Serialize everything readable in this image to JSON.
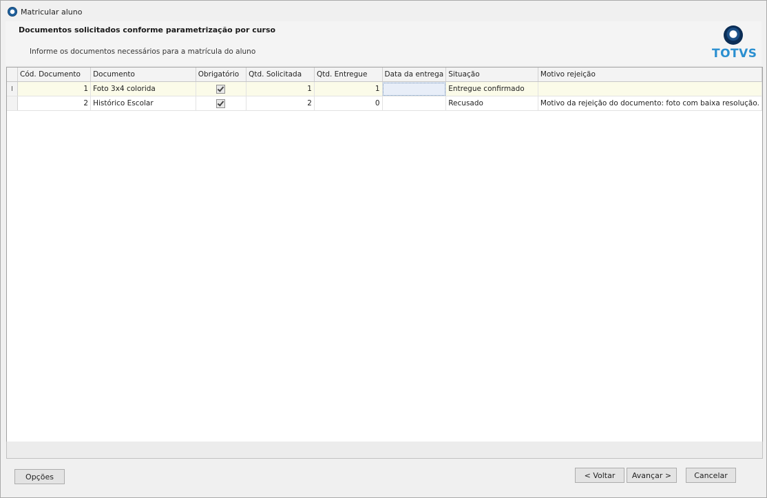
{
  "window": {
    "title": "Matricular aluno"
  },
  "header": {
    "title": "Documentos solicitados conforme parametrização por curso",
    "subtitle": "Informe os documentos necessários para a matrícula do aluno",
    "logo_text": "TOTVS"
  },
  "grid": {
    "columns": [
      "Cód. Documento",
      "Documento",
      "Obrigatório",
      "Qtd. Solicitada",
      "Qtd. Entregue",
      "Data da entrega",
      "Situação",
      "Motivo rejeição"
    ],
    "rows": [
      {
        "indicator": "I",
        "cod": "1",
        "documento": "Foto 3x4 colorida",
        "obrigatorio": true,
        "qtd_solicitada": "1",
        "qtd_entregue": "1",
        "data_entrega": "",
        "situacao": "Entregue confirmado",
        "motivo": ""
      },
      {
        "indicator": "",
        "cod": "2",
        "documento": "Histórico Escolar",
        "obrigatorio": true,
        "qtd_solicitada": "2",
        "qtd_entregue": "0",
        "data_entrega": "",
        "situacao": "Recusado",
        "motivo": "Motivo da rejeição do documento: foto com baixa resolução."
      }
    ]
  },
  "buttons": {
    "opcoes": "Opções",
    "voltar": "< Voltar",
    "avancar": "Avançar >",
    "cancelar": "Cancelar"
  }
}
